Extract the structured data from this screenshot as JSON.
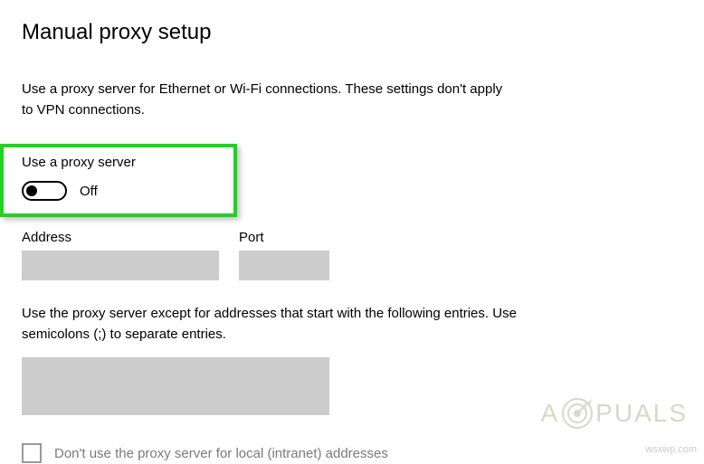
{
  "section": {
    "title": "Manual proxy setup",
    "description": "Use a proxy server for Ethernet or Wi-Fi connections. These settings don't apply to VPN connections."
  },
  "proxy_toggle": {
    "label": "Use a proxy server",
    "state": "Off"
  },
  "fields": {
    "address_label": "Address",
    "address_value": "",
    "port_label": "Port",
    "port_value": ""
  },
  "exceptions": {
    "description": "Use the proxy server except for addresses that start with the following entries. Use semicolons (;) to separate entries.",
    "value": ""
  },
  "local_bypass": {
    "label": "Don't use the proxy server for local (intranet) addresses",
    "checked": false
  },
  "watermark": {
    "text_before": "A",
    "text_after": "PUALS"
  },
  "source": "wsxwp.com"
}
